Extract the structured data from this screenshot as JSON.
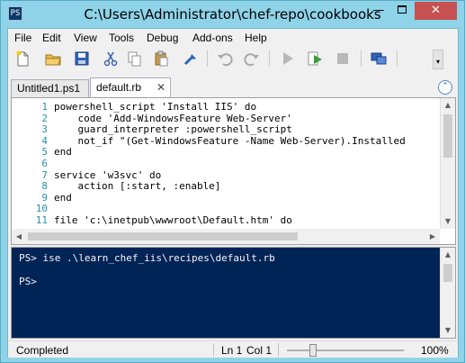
{
  "window": {
    "title": "C:\\Users\\Administrator\\chef-repo\\cookbooks",
    "app_icon": "PS",
    "minimize_label": "—",
    "close_label": "✕"
  },
  "menu": [
    "File",
    "Edit",
    "View",
    "Tools",
    "Debug",
    "Add-ons",
    "Help"
  ],
  "toolbar": {
    "icons": [
      "new-file-icon",
      "open-folder-icon",
      "save-icon",
      "cut-icon",
      "copy-icon",
      "paste-icon",
      "clear-console-icon",
      "undo-icon",
      "redo-icon",
      "run-script-icon",
      "run-selection-icon",
      "stop-icon",
      "remote-powershell-icon"
    ],
    "overflow": "▾"
  },
  "tabs": [
    {
      "label": "Untitled1.ps1",
      "active": false
    },
    {
      "label": "default.rb",
      "active": true,
      "close": "✕"
    }
  ],
  "collapse_icon": "⌃",
  "editor": {
    "line_numbers": [
      "1",
      "2",
      "3",
      "4",
      "5",
      "6",
      "7",
      "8",
      "9",
      "10",
      "11"
    ],
    "lines": [
      "powershell_script 'Install IIS' do",
      "    code 'Add-WindowsFeature Web-Server'",
      "    guard_interpreter :powershell_script",
      "    not_if \"(Get-WindowsFeature -Name Web-Server).Installed",
      "end",
      "",
      "service 'w3svc' do",
      "    action [:start, :enable]",
      "end",
      "",
      "file 'c:\\inetpub\\wwwroot\\Default.htm' do"
    ]
  },
  "console": {
    "lines": [
      "PS> ise .\\learn_chef_iis\\recipes\\default.rb",
      "",
      "PS>"
    ]
  },
  "status": {
    "text": "Completed",
    "line": "Ln 1",
    "col": "Col 1",
    "zoom": "100%",
    "zoom_level": 0.22
  },
  "colors": {
    "title_bar": "#8fd3e8",
    "close_button": "#c75050",
    "console_background": "#012456",
    "line_number": "#2b91af"
  }
}
